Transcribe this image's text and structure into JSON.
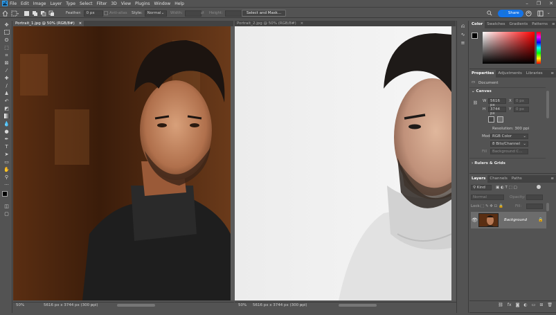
{
  "app": {
    "logo": "Ps",
    "menu": [
      "File",
      "Edit",
      "Image",
      "Layer",
      "Type",
      "Select",
      "Filter",
      "3D",
      "View",
      "Plugins",
      "Window",
      "Help"
    ],
    "window_controls": [
      "–",
      "❐",
      "✕"
    ]
  },
  "options_bar": {
    "feather_label": "Feather:",
    "feather_value": "0 px",
    "anti_alias_label": "Anti-alias",
    "style_label": "Style:",
    "style_value": "Normal",
    "width_label": "Width:",
    "height_label": "Height:",
    "select_mask_label": "Select and Mask...",
    "share_label": "Share"
  },
  "documents": [
    {
      "tab_title": "Portrait_1.jpg @ 50% (RGB/8#)",
      "close": "×",
      "zoom": "50%",
      "doc_info": "5616 px x 3744 px (300 ppi)"
    },
    {
      "tab_title": "Portrait_2.jpg @ 50% (RGB/8#)",
      "close": "×",
      "zoom": "50%",
      "doc_info": "5616 px x 3744 px (300 ppi)"
    }
  ],
  "color_panel": {
    "tabs": [
      "Color",
      "Swatches",
      "Gradients",
      "Patterns"
    ],
    "hue_color": "#ff0000"
  },
  "properties_panel": {
    "tabs": [
      "Properties",
      "Adjustments",
      "Libraries"
    ],
    "doc_label": "Document",
    "canvas_section": "Canvas",
    "w_label": "W",
    "w_value": "5616 px",
    "x_label": "X",
    "x_value": "0 px",
    "h_label": "H",
    "h_value": "3744 px",
    "y_label": "Y",
    "y_value": "0 px",
    "resolution": "Resolution: 300 ppi",
    "mode_label": "Mode",
    "mode_value": "RGB Color",
    "depth_value": "8 Bits/Channel",
    "fill_label": "Fill",
    "fill_value": "Background C...",
    "rulers_section": "Rulers & Grids"
  },
  "layers_panel": {
    "tabs": [
      "Layers",
      "Channels",
      "Paths"
    ],
    "kind_label": "Kind",
    "blend_mode": "Normal",
    "opacity_label": "Opacity:",
    "lock_label": "Lock:",
    "fill_label": "Fill:",
    "layer_name": "Background"
  },
  "colors": {
    "accent": "#1473e6",
    "panel_bg": "#535353",
    "tab_bg": "#424242"
  }
}
